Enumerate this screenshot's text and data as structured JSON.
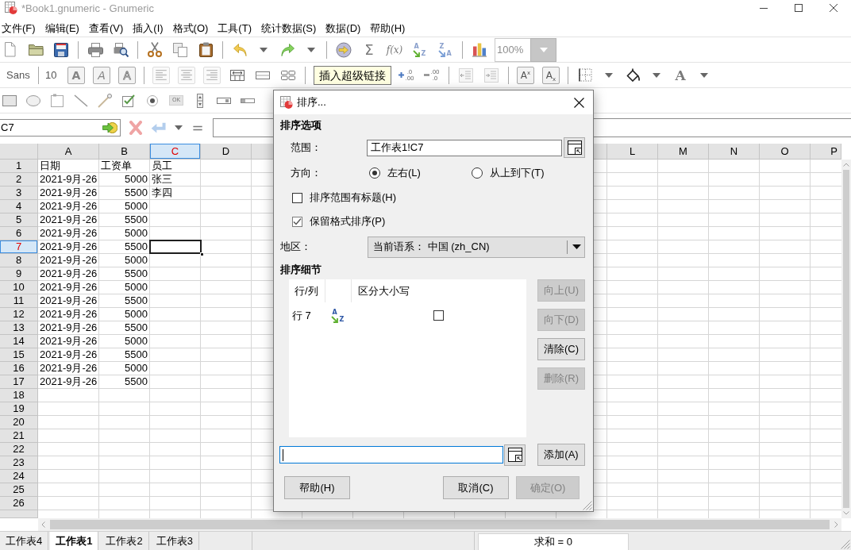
{
  "window": {
    "title": "*Book1.gnumeric - Gnumeric"
  },
  "menu": [
    "文件(F)",
    "编辑(E)",
    "查看(V)",
    "插入(I)",
    "格式(O)",
    "工具(T)",
    "统计数据(S)",
    "数据(D)",
    "帮助(H)"
  ],
  "standard_toolbar": [
    {
      "kind": "new"
    },
    {
      "kind": "open"
    },
    {
      "kind": "save"
    },
    {
      "kind": "separator"
    },
    {
      "kind": "print"
    },
    {
      "kind": "print_preview"
    },
    {
      "kind": "separator"
    },
    {
      "kind": "cut"
    },
    {
      "kind": "copy"
    },
    {
      "kind": "paste"
    },
    {
      "kind": "separator"
    },
    {
      "kind": "undo"
    },
    {
      "kind": "menu_arrow"
    },
    {
      "kind": "redo"
    },
    {
      "kind": "menu_arrow"
    },
    {
      "kind": "separator"
    },
    {
      "kind": "hyperlink"
    },
    {
      "kind": "sum",
      "glyph": "Σ"
    },
    {
      "kind": "function",
      "glyph": "f(x)"
    },
    {
      "kind": "sort_ascending",
      "glyphs": [
        "A",
        "Z"
      ]
    },
    {
      "kind": "sort_descending",
      "glyphs": [
        "Z",
        "A"
      ]
    },
    {
      "kind": "separator"
    },
    {
      "kind": "chart"
    },
    {
      "kind": "zoom",
      "value": "100%"
    }
  ],
  "format_toolbar": [
    {
      "kind": "font_name",
      "value": "Sans"
    },
    {
      "kind": "separator"
    },
    {
      "kind": "font_size",
      "value": "10"
    },
    {
      "kind": "bold",
      "glyph": "A"
    },
    {
      "kind": "italic",
      "glyph": "A"
    },
    {
      "kind": "outline",
      "glyph": "A"
    },
    {
      "kind": "separator"
    },
    {
      "kind": "align_left"
    },
    {
      "kind": "align_center"
    },
    {
      "kind": "align_right"
    },
    {
      "kind": "merge_center"
    },
    {
      "kind": "merge"
    },
    {
      "kind": "unmerge"
    },
    {
      "kind": "separator"
    },
    {
      "kind": "tooltip",
      "text": "插入超级链接"
    },
    {
      "kind": "increase_decimals",
      "glyphs": [
        ".0",
        ".00"
      ]
    },
    {
      "kind": "decrease_decimals",
      "glyphs": [
        ".00",
        ".0"
      ]
    },
    {
      "kind": "separator"
    },
    {
      "kind": "outdent"
    },
    {
      "kind": "indent"
    },
    {
      "kind": "separator"
    },
    {
      "kind": "superscript",
      "glyph": "A",
      "index": "x"
    },
    {
      "kind": "subscript",
      "glyph": "A",
      "index": "x"
    },
    {
      "kind": "separator"
    },
    {
      "kind": "borders"
    },
    {
      "kind": "menu_arrow"
    },
    {
      "kind": "fill_color"
    },
    {
      "kind": "menu_arrow"
    },
    {
      "kind": "font_color",
      "glyph": "A"
    },
    {
      "kind": "menu_arrow"
    }
  ],
  "object_toolbar": [
    {
      "kind": "rectangle"
    },
    {
      "kind": "ellipse"
    },
    {
      "kind": "frame"
    },
    {
      "kind": "line"
    },
    {
      "kind": "arrow"
    },
    {
      "kind": "checkbox"
    },
    {
      "kind": "radio"
    },
    {
      "kind": "button",
      "glyph": "OK"
    },
    {
      "kind": "spin"
    },
    {
      "kind": "scrollbar"
    },
    {
      "kind": "slider"
    }
  ],
  "formula_bar": {
    "name_box": "C7",
    "buttons": [
      {
        "kind": "cancel",
        "disabled": true
      },
      {
        "kind": "accept",
        "disabled": true
      },
      {
        "kind": "menu_arrow"
      },
      {
        "kind": "equals",
        "glyph": "="
      }
    ]
  },
  "sheet": {
    "columns_left": [
      {
        "label": "A",
        "selected": false
      },
      {
        "label": "B",
        "selected": false
      },
      {
        "label": "C",
        "selected": true
      },
      {
        "label": "D",
        "selected": false
      }
    ],
    "columns_right": [
      {
        "label": "L",
        "selected": false
      },
      {
        "label": "M",
        "selected": false
      },
      {
        "label": "N",
        "selected": false
      },
      {
        "label": "O",
        "selected": false
      },
      {
        "label": "P",
        "selected": false
      }
    ],
    "rows": [
      {
        "number": "1",
        "selected": false,
        "cells": [
          {
            "kind": "text",
            "text": "日期"
          },
          {
            "kind": "text",
            "text": "工资单"
          },
          {
            "kind": "text",
            "text": "员工"
          }
        ]
      },
      {
        "number": "2",
        "selected": false,
        "cells": [
          {
            "kind": "text",
            "text": "2021-9月-26"
          },
          {
            "kind": "number",
            "text": "5000"
          },
          {
            "kind": "text",
            "text": "张三"
          }
        ]
      },
      {
        "number": "3",
        "selected": false,
        "cells": [
          {
            "kind": "text",
            "text": "2021-9月-26"
          },
          {
            "kind": "number",
            "text": "5500"
          },
          {
            "kind": "text",
            "text": "李四"
          }
        ]
      },
      {
        "number": "4",
        "selected": false,
        "cells": [
          {
            "kind": "text",
            "text": "2021-9月-26"
          },
          {
            "kind": "number",
            "text": "5000"
          }
        ]
      },
      {
        "number": "5",
        "selected": false,
        "cells": [
          {
            "kind": "text",
            "text": "2021-9月-26"
          },
          {
            "kind": "number",
            "text": "5500"
          }
        ]
      },
      {
        "number": "6",
        "selected": false,
        "cells": [
          {
            "kind": "text",
            "text": "2021-9月-26"
          },
          {
            "kind": "number",
            "text": "5000"
          }
        ]
      },
      {
        "number": "7",
        "selected": true,
        "cells": [
          {
            "kind": "text",
            "text": "2021-9月-26"
          },
          {
            "kind": "number",
            "text": "5500"
          }
        ]
      },
      {
        "number": "8",
        "selected": false,
        "cells": [
          {
            "kind": "text",
            "text": "2021-9月-26"
          },
          {
            "kind": "number",
            "text": "5000"
          }
        ]
      },
      {
        "number": "9",
        "selected": false,
        "cells": [
          {
            "kind": "text",
            "text": "2021-9月-26"
          },
          {
            "kind": "number",
            "text": "5500"
          }
        ]
      },
      {
        "number": "10",
        "selected": false,
        "cells": [
          {
            "kind": "text",
            "text": "2021-9月-26"
          },
          {
            "kind": "number",
            "text": "5000"
          }
        ]
      },
      {
        "number": "11",
        "selected": false,
        "cells": [
          {
            "kind": "text",
            "text": "2021-9月-26"
          },
          {
            "kind": "number",
            "text": "5500"
          }
        ]
      },
      {
        "number": "12",
        "selected": false,
        "cells": [
          {
            "kind": "text",
            "text": "2021-9月-26"
          },
          {
            "kind": "number",
            "text": "5000"
          }
        ]
      },
      {
        "number": "13",
        "selected": false,
        "cells": [
          {
            "kind": "text",
            "text": "2021-9月-26"
          },
          {
            "kind": "number",
            "text": "5500"
          }
        ]
      },
      {
        "number": "14",
        "selected": false,
        "cells": [
          {
            "kind": "text",
            "text": "2021-9月-26"
          },
          {
            "kind": "number",
            "text": "5000"
          }
        ]
      },
      {
        "number": "15",
        "selected": false,
        "cells": [
          {
            "kind": "text",
            "text": "2021-9月-26"
          },
          {
            "kind": "number",
            "text": "5500"
          }
        ]
      },
      {
        "number": "16",
        "selected": false,
        "cells": [
          {
            "kind": "text",
            "text": "2021-9月-26"
          },
          {
            "kind": "number",
            "text": "5000"
          }
        ]
      },
      {
        "number": "17",
        "selected": false,
        "cells": [
          {
            "kind": "text",
            "text": "2021-9月-26"
          },
          {
            "kind": "number",
            "text": "5500"
          }
        ]
      },
      {
        "number": "18",
        "selected": false
      },
      {
        "number": "19",
        "selected": false
      },
      {
        "number": "20",
        "selected": false
      },
      {
        "number": "21",
        "selected": false
      },
      {
        "number": "22",
        "selected": false
      },
      {
        "number": "23",
        "selected": false
      },
      {
        "number": "24",
        "selected": false
      },
      {
        "number": "25",
        "selected": false
      },
      {
        "number": "26",
        "selected": false
      }
    ]
  },
  "sheet_tabs": [
    {
      "label": "工作表4",
      "selected": false
    },
    {
      "label": "工作表1",
      "selected": true
    },
    {
      "label": "工作表2",
      "selected": false
    },
    {
      "label": "工作表3",
      "selected": false
    }
  ],
  "status_bar": {
    "sum": "求和 = 0"
  },
  "sort_dialog": {
    "title": "排序...",
    "options_heading": "排序选项",
    "range": {
      "label": "范围：",
      "value": "工作表1!C7"
    },
    "direction": {
      "label": "方向：",
      "options": [
        {
          "label": "左右(L)",
          "selected": true
        },
        {
          "label": "从上到下(T)",
          "selected": false
        }
      ]
    },
    "checkboxes": [
      {
        "label": "排序范围有标题(H)",
        "checked": false
      },
      {
        "label": "保留格式排序(P)",
        "checked": true
      }
    ],
    "locale": {
      "label": "地区：",
      "value": "当前语系： 中国 (zh_CN)"
    },
    "details_heading": "排序细节",
    "details": {
      "columns": [
        {
          "kind": "key",
          "label": "行/列"
        },
        {
          "kind": "order"
        },
        {
          "kind": "case",
          "label": "区分大小写"
        }
      ],
      "rows": [
        {
          "key": "行 7",
          "order_glyphs": [
            "A",
            "Z"
          ],
          "case_sensitive": false
        }
      ]
    },
    "side_buttons": [
      {
        "label": "向上(U)",
        "disabled": true
      },
      {
        "label": "向下(D)",
        "disabled": true
      },
      {
        "label": "清除(C)",
        "disabled": false
      },
      {
        "label": "删除(R)",
        "disabled": true
      }
    ],
    "criteria_field": {
      "focused": true
    },
    "add_button": {
      "label": "添加(A)"
    },
    "footer_buttons": [
      {
        "label": "帮助(H)",
        "disabled": false
      },
      {
        "label": "取消(C)",
        "disabled": false
      },
      {
        "label": "确定(O)",
        "disabled": true
      }
    ]
  }
}
